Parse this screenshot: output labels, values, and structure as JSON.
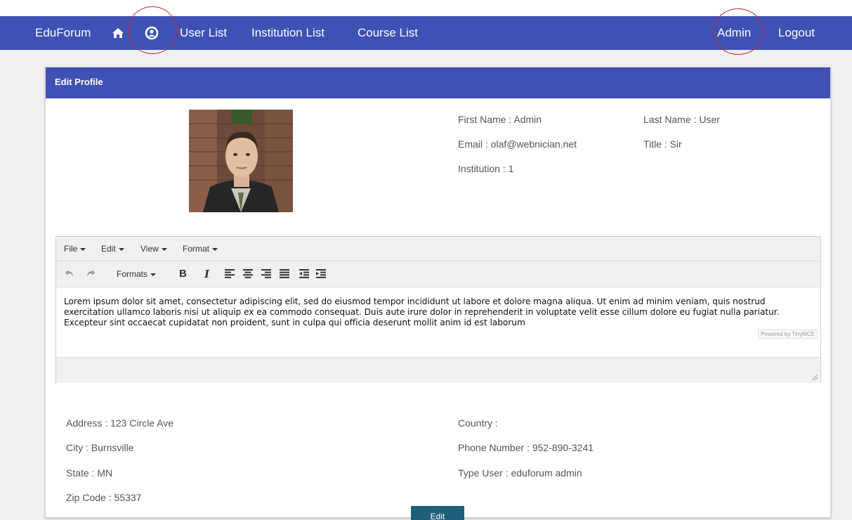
{
  "nav": {
    "brand": "EduForum",
    "home_icon": "home-icon",
    "profile_icon": "user-circle-icon",
    "links": [
      "User List",
      "Institution List",
      "Course List"
    ],
    "admin": "Admin",
    "logout": "Logout",
    "color": "#3f51b5"
  },
  "panel": {
    "title": "Edit Profile"
  },
  "profile": {
    "first_name": "First Name : Admin",
    "last_name": "Last Name : User",
    "email": "Email : olaf@webnician.net",
    "title": "Title : Sir",
    "institution": "Institution : 1"
  },
  "editor": {
    "menus": [
      "File",
      "Edit",
      "View",
      "Format"
    ],
    "formats_label": "Formats",
    "bold": "B",
    "italic": "I",
    "content": "Lorem ipsum dolor sit amet, consectetur adipiscing elit, sed do eiusmod tempor incididunt ut labore et dolore magna aliqua. Ut enim ad minim veniam, quis nostrud exercitation ullamco laboris nisi ut aliquip ex ea commodo consequat. Duis aute irure dolor in reprehenderit in voluptate velit esse cillum dolore eu fugiat nulla pariatur. Excepteur sint occaecat cupidatat non proident, sunt in culpa qui officia deserunt mollit anim id est laborum",
    "powered_by": "Powered by TinyMCE"
  },
  "details": {
    "address": "Address : 123 Circle Ave",
    "city": "City : Burnsville",
    "state": "State : MN",
    "zip": "Zip Code : 55337",
    "country": "Country :",
    "phone": "Phone Number : 952-890-3241",
    "type_user": "Type User : eduforum admin"
  },
  "edit_button": "Edit"
}
